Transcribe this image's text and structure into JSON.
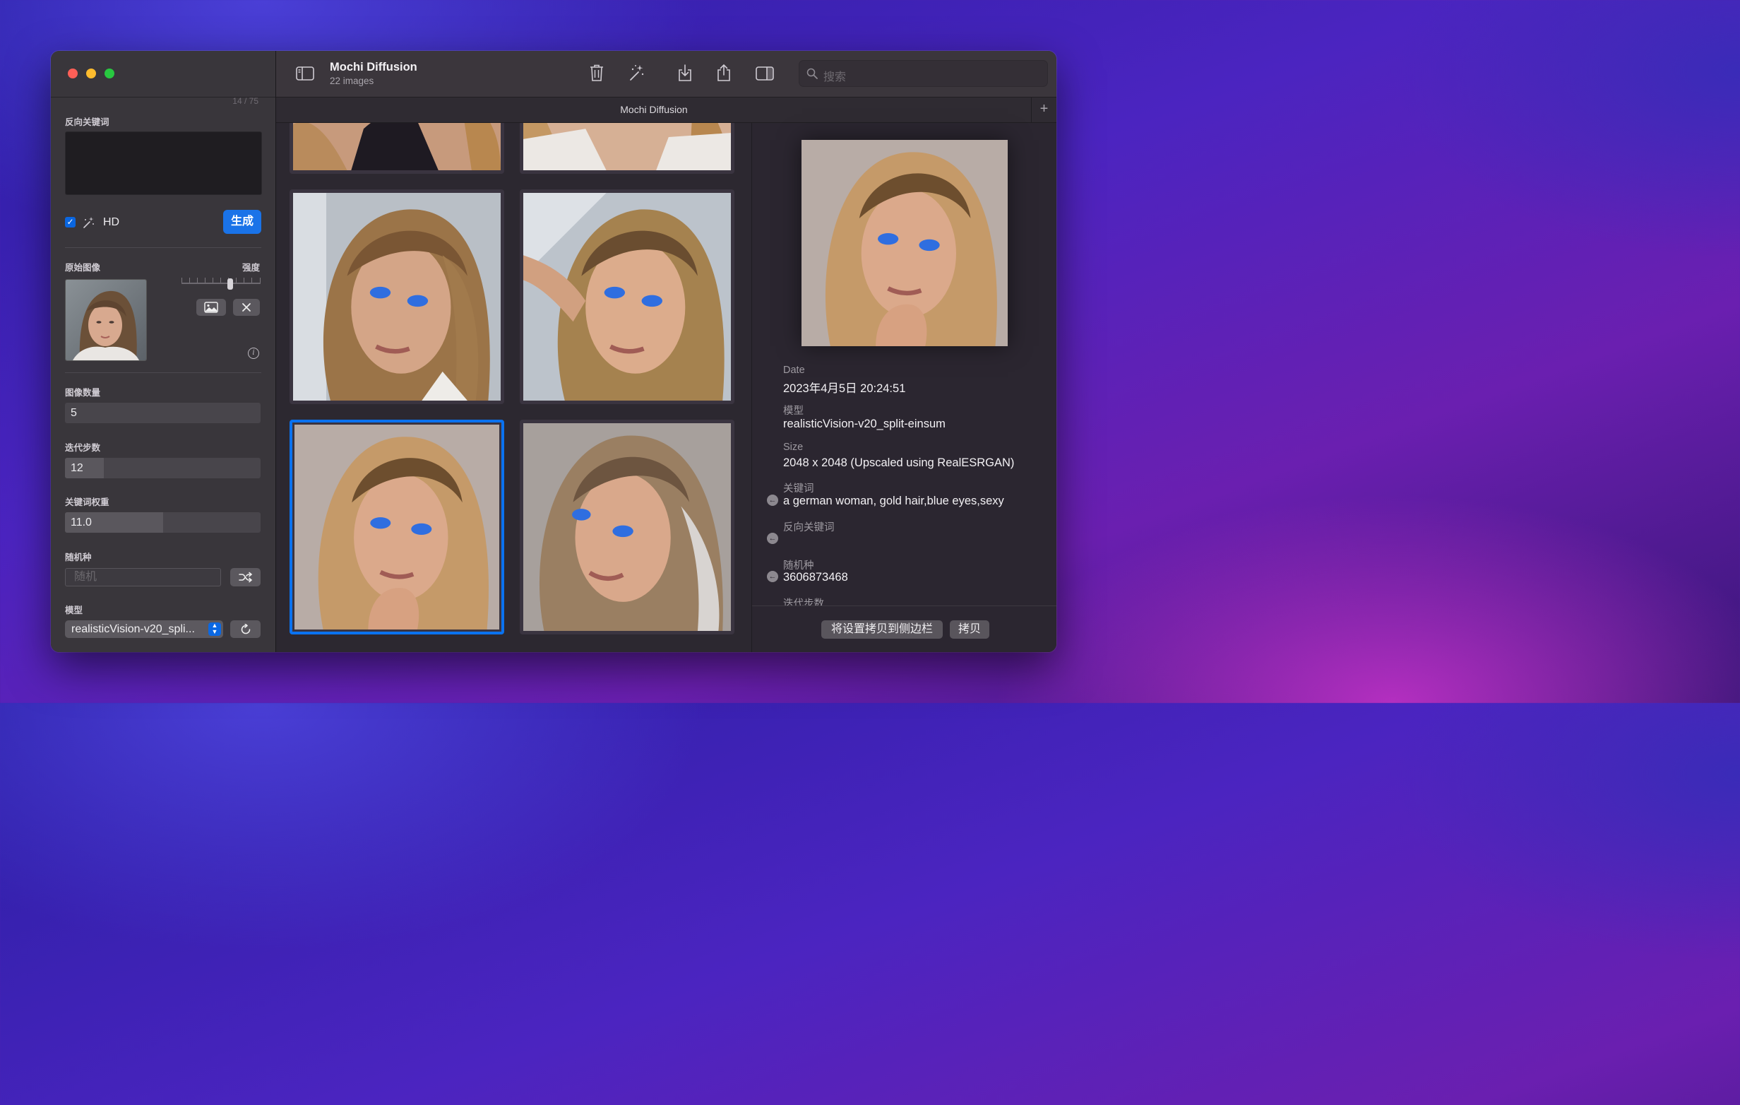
{
  "window": {
    "title": "Mochi Diffusion",
    "subtitle": "22 images",
    "tab_title": "Mochi Diffusion",
    "search_placeholder": "搜索"
  },
  "sidebar": {
    "counter": "14 / 75",
    "negative_prompt_label": "反向关键词",
    "negative_prompt_value": "",
    "hd_checked": true,
    "hd_label": "HD",
    "generate_label": "生成",
    "source_image_label": "原始图像",
    "strength_label": "强度",
    "strength_value": 0.62,
    "image_count_label": "图像数量",
    "image_count_value": "5",
    "steps_label": "迭代步数",
    "steps_value": "12",
    "steps_fill": 0.2,
    "guidance_label": "关键词权重",
    "guidance_value": "11.0",
    "guidance_fill": 0.5,
    "seed_label": "随机种",
    "seed_placeholder": "随机",
    "model_label": "模型",
    "model_value": "realisticVision-v20_spli..."
  },
  "inspector": {
    "date_label": "Date",
    "date_value": "2023年4月5日 20:24:51",
    "model_label": "模型",
    "model_value": "realisticVision-v20_split-einsum",
    "size_label": "Size",
    "size_value": "2048 x 2048 (Upscaled using RealESRGAN)",
    "prompt_label": "关键词",
    "prompt_value": "a german woman, gold hair,blue eyes,sexy",
    "neg_label": "反向关键词",
    "neg_value": "",
    "seed_label": "随机种",
    "seed_value": "3606873468",
    "steps_label": "迭代步数",
    "copy_to_sidebar_label": "将设置拷贝到侧边栏",
    "copy_label": "拷贝"
  },
  "icons": [
    "sidebar-toggle-icon",
    "trash-icon",
    "magic-wand-icon",
    "download-icon",
    "share-icon",
    "inspector-toggle-icon",
    "search-icon",
    "image-icon",
    "close-icon",
    "info-icon",
    "shuffle-icon",
    "refresh-icon",
    "plus-icon",
    "back-arrow-icon"
  ],
  "colors": {
    "accent": "#0a72f0",
    "generate": "#1a73e8"
  }
}
